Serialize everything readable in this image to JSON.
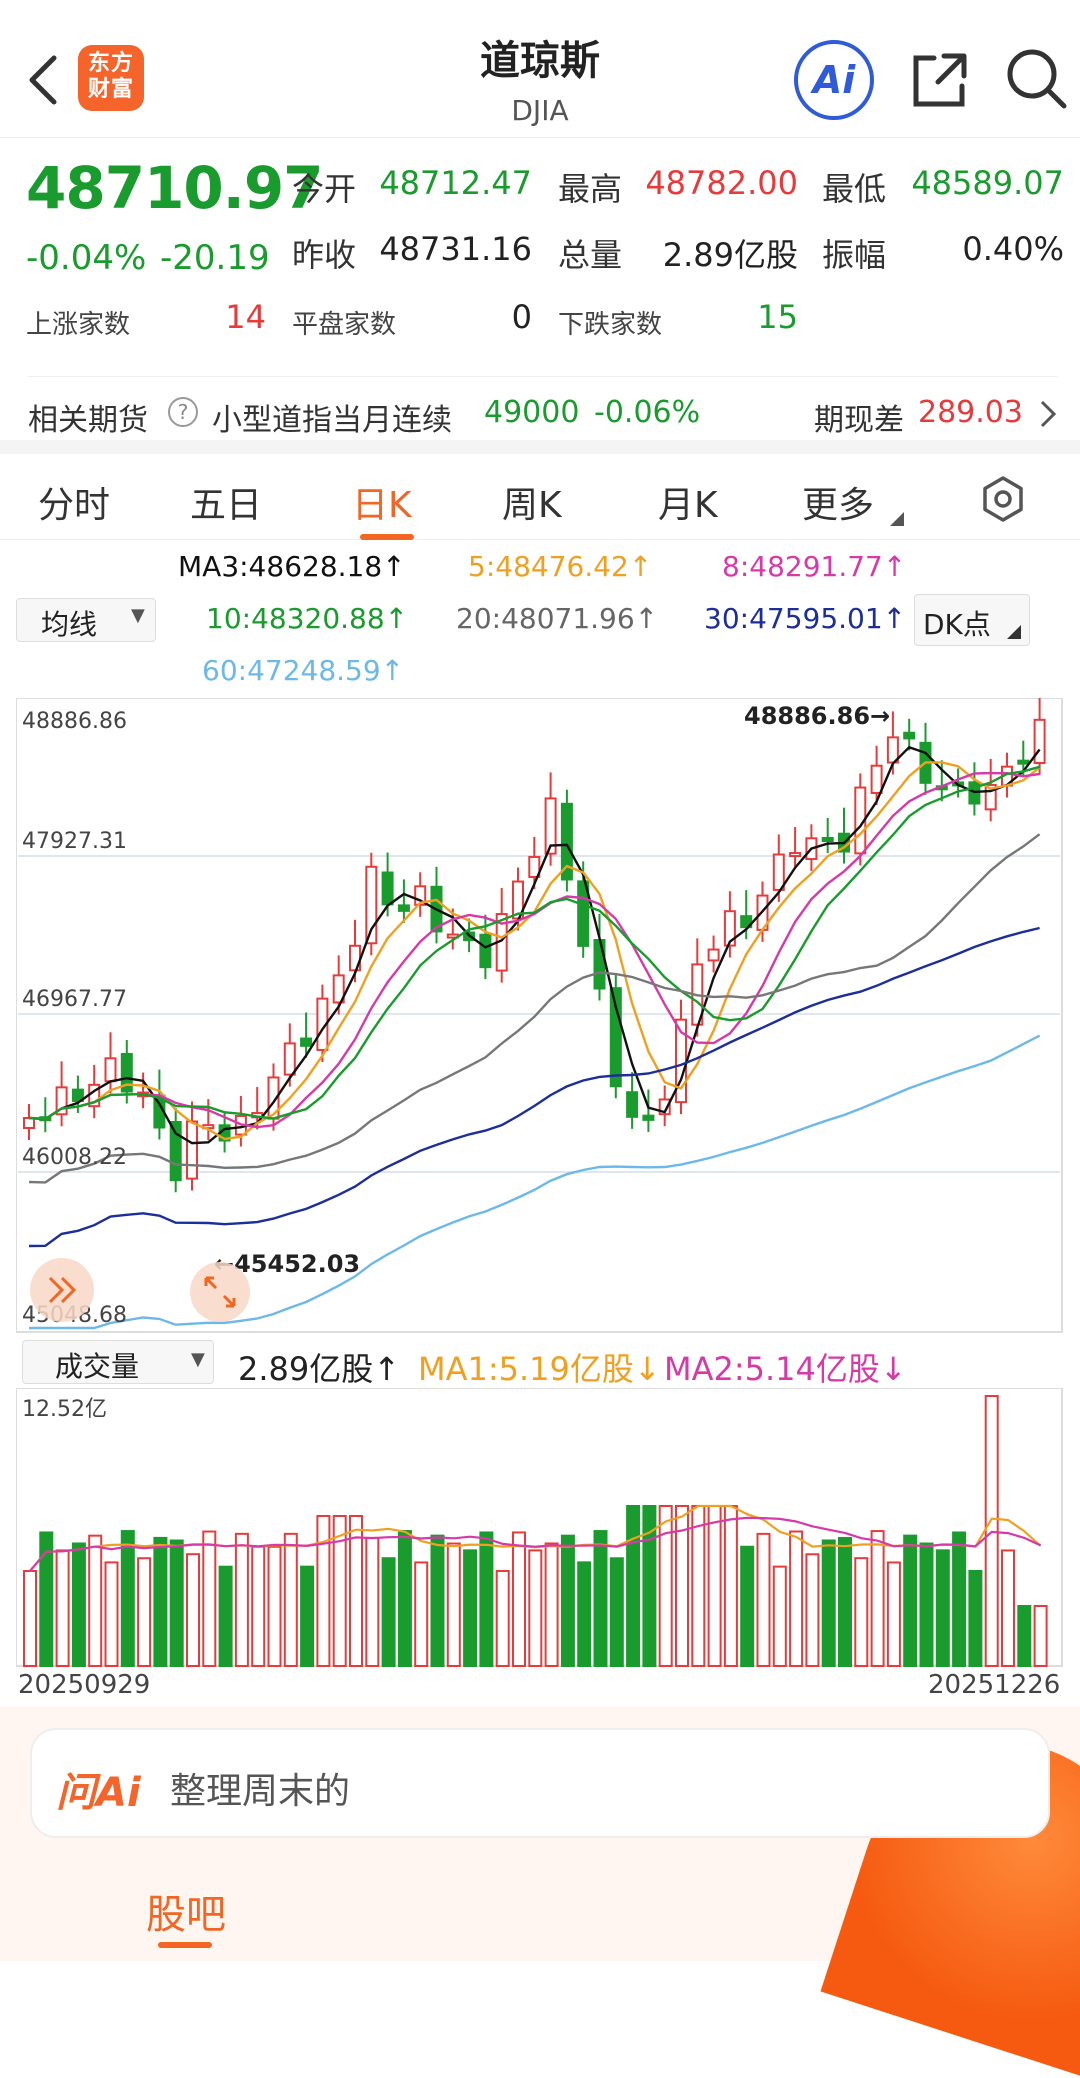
{
  "header": {
    "logo_text": "东方财富",
    "title": "道琼斯",
    "subtitle": "DJIA",
    "ai_label": "Ai"
  },
  "quote": {
    "price": "48710.97",
    "change_pct": "-0.04%",
    "change": "-20.19",
    "open_label": "今开",
    "open": "48712.47",
    "high_label": "最高",
    "high": "48782.00",
    "low_label": "最低",
    "low": "48589.07",
    "prev_close_label": "昨收",
    "prev_close": "48731.16",
    "volume_label": "总量",
    "volume": "2.89亿股",
    "amplitude_label": "振幅",
    "amplitude": "0.40%",
    "up_label": "上涨家数",
    "up_count": "14",
    "flat_label": "平盘家数",
    "flat_count": "0",
    "down_label": "下跌家数",
    "down_count": "15"
  },
  "futures": {
    "label": "相关期货",
    "name": "小型道指当月连续",
    "price": "49000",
    "pct": "-0.06%",
    "basis_label": "期现差",
    "basis": "289.03"
  },
  "tabs": [
    "分时",
    "五日",
    "日K",
    "周K",
    "月K",
    "更多"
  ],
  "ma": {
    "selector": "均线",
    "ma3": "MA3:48628.18↑",
    "ma5": "5:48476.42↑",
    "ma8": "8:48291.77↑",
    "ma10": "10:48320.88↑",
    "ma20": "20:48071.96↑",
    "ma30": "30:47595.01↑",
    "ma60": "60:47248.59↑",
    "dk": "DK点"
  },
  "kline": {
    "y_labels": [
      "48886.86",
      "47927.31",
      "46967.77",
      "46008.22",
      "45048.68"
    ],
    "max_marker": "48886.86→",
    "min_marker": "←45452.03"
  },
  "volume": {
    "selector": "成交量",
    "value": "2.89亿股↑",
    "ma1": "MA1:5.19亿股↓",
    "ma2": "MA2:5.14亿股↓",
    "max_label": "12.52亿",
    "start_date": "20250929",
    "end_date": "20251226"
  },
  "colors": {
    "up": "#e83a3a",
    "down": "#1a9b2e",
    "accent": "#f26522",
    "ma3": "#111111",
    "ma5": "#f0a020",
    "ma8": "#d63aa8",
    "ma10": "#1a9b2e",
    "ma20": "#777777",
    "ma30": "#1c2e9a",
    "ma60": "#6cb8e8"
  },
  "bottom": {
    "ai_brand": "问Ai",
    "ask_text": "整理周末的",
    "tab": "股吧"
  }
}
